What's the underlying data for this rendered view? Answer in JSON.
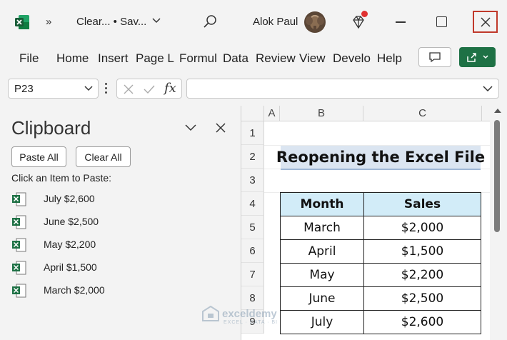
{
  "titlebar": {
    "app_icon": "excel-logo-icon",
    "more_glyph": "»",
    "doc_title": "Clear... • Sav...",
    "user_name": "Alok Paul",
    "icons": {
      "search": "search-icon",
      "diamond": "diamond-icon",
      "minimize": "minimize-icon",
      "maximize": "maximize-icon",
      "close": "close-icon"
    },
    "close_highlight_color": "#c0392b"
  },
  "ribbon": {
    "tabs": [
      "File",
      "Home",
      "Insert",
      "Page La",
      "Formul",
      "Data",
      "Review",
      "View",
      "Develo",
      "Help"
    ],
    "share_color": "#1e7145"
  },
  "formula_bar": {
    "name_box": "P23",
    "fx_label": "fx",
    "formula_value": ""
  },
  "clipboard": {
    "title": "Clipboard",
    "paste_all": "Paste All",
    "clear_all": "Clear All",
    "hint": "Click an Item to Paste:",
    "items": [
      "July $2,600",
      "June $2,500",
      "May $2,200",
      "April $1,500",
      "March $2,000"
    ]
  },
  "sheet": {
    "columns": [
      "A",
      "B",
      "C"
    ],
    "rows": [
      "1",
      "2",
      "3",
      "4",
      "5",
      "6",
      "7",
      "8",
      "9"
    ],
    "title": "Reopening the Excel File",
    "table": {
      "headers": [
        "Month",
        "Sales"
      ],
      "rows": [
        [
          "March",
          "$2,000"
        ],
        [
          "April",
          "$1,500"
        ],
        [
          "May",
          "$2,200"
        ],
        [
          "June",
          "$2,500"
        ],
        [
          "July",
          "$2,600"
        ]
      ]
    },
    "header_fill": "#d2ecf8",
    "title_fill": "#dbe5f1"
  },
  "watermark": {
    "name": "exceldemy",
    "tagline": "EXCEL · DATA · BI"
  }
}
